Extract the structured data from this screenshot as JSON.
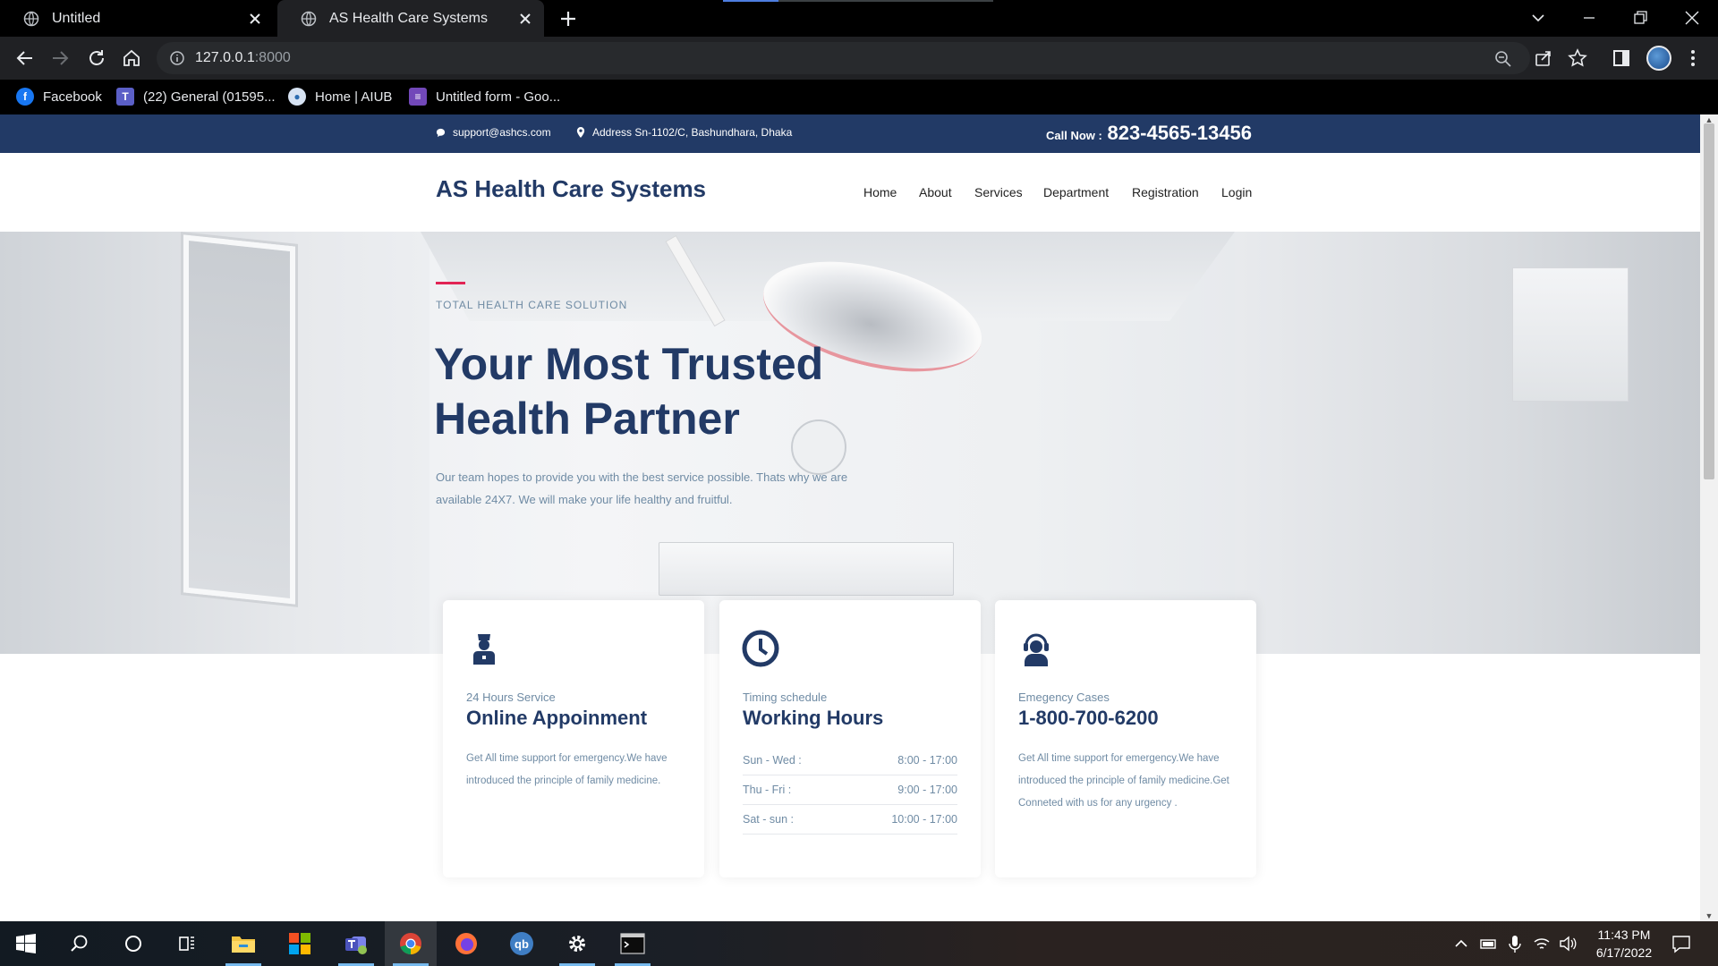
{
  "browser": {
    "tabs": [
      {
        "title": "Untitled",
        "active": false
      },
      {
        "title": "AS Health Care Systems",
        "active": true
      }
    ],
    "address": {
      "host": "127.0.0.1",
      "port": ":8000"
    },
    "bookmarks": [
      {
        "label": "Facebook",
        "icon": "facebook-icon",
        "color": "#1877f2"
      },
      {
        "label": "(22) General (01595...",
        "icon": "teams-icon",
        "color": "#5b5fc7"
      },
      {
        "label": "Home | AIUB",
        "icon": "aiub-icon",
        "color": "#2b6cb0"
      },
      {
        "label": "Untitled form - Goo...",
        "icon": "google-forms-icon",
        "color": "#7248b9"
      }
    ]
  },
  "site": {
    "topbar": {
      "email": "support@ashcs.com",
      "address": "Address Sn-1102/C, Bashundhara, Dhaka",
      "call_label": "Call Now :",
      "phone": "823-4565-13456"
    },
    "brand": "AS Health Care Systems",
    "nav": [
      "Home",
      "About",
      "Services",
      "Department",
      "Registration",
      "Login"
    ],
    "hero": {
      "kicker": "TOTAL HEALTH CARE SOLUTION",
      "title": "Your Most Trusted Health Partner",
      "description": "Our team hopes to provide you with the best service possible. Thats why we are available 24X7. We will make your life healthy and fruitful."
    },
    "cards": [
      {
        "icon": "doctor-icon",
        "subtitle": "24 Hours Service",
        "title": "Online Appoinment",
        "body": "Get All time support for emergency.We have introduced the principle of family medicine."
      },
      {
        "icon": "clock-icon",
        "subtitle": "Timing schedule",
        "title": "Working Hours",
        "schedule": [
          {
            "day": "Sun - Wed :",
            "time": "8:00 - 17:00"
          },
          {
            "day": "Thu - Fri :",
            "time": "9:00 - 17:00"
          },
          {
            "day": "Sat - sun :",
            "time": "10:00 - 17:00"
          }
        ]
      },
      {
        "icon": "support-agent-icon",
        "subtitle": "Emegency Cases",
        "title": "1-800-700-6200",
        "body": "Get All time support for emergency.We have introduced the principle of family medicine.Get Conneted with us for any urgency ."
      }
    ],
    "colors": {
      "primary": "#223a66",
      "accent": "#e12454",
      "muted": "#6f8ba4"
    }
  },
  "taskbar": {
    "apps": [
      "start-icon",
      "search-icon",
      "cortana-icon",
      "task-view-icon",
      "file-explorer-icon",
      "office-icon",
      "teams-icon",
      "chrome-icon",
      "firefox-icon",
      "qbittorrent-icon",
      "settings-icon",
      "terminal-icon"
    ],
    "time": "11:43 PM",
    "date": "6/17/2022"
  }
}
